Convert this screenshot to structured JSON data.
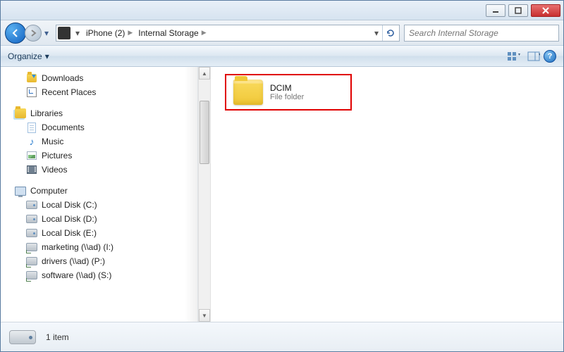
{
  "breadcrumb": {
    "device": "iPhone (2)",
    "location": "Internal Storage"
  },
  "search": {
    "placeholder": "Search Internal Storage"
  },
  "toolbar": {
    "organize": "Organize"
  },
  "nav": {
    "downloads": "Downloads",
    "recent": "Recent Places",
    "libraries": "Libraries",
    "documents": "Documents",
    "music": "Music",
    "pictures": "Pictures",
    "videos": "Videos",
    "computer": "Computer",
    "disk_c": "Local Disk (C:)",
    "disk_d": "Local Disk (D:)",
    "disk_e": "Local Disk (E:)",
    "net_marketing": "marketing (\\\\ad) (I:)",
    "net_drivers": "drivers (\\\\ad) (P:)",
    "net_software": "software (\\\\ad) (S:)"
  },
  "content": {
    "items": [
      {
        "name": "DCIM",
        "type": "File folder"
      }
    ]
  },
  "status": {
    "count": "1 item"
  }
}
